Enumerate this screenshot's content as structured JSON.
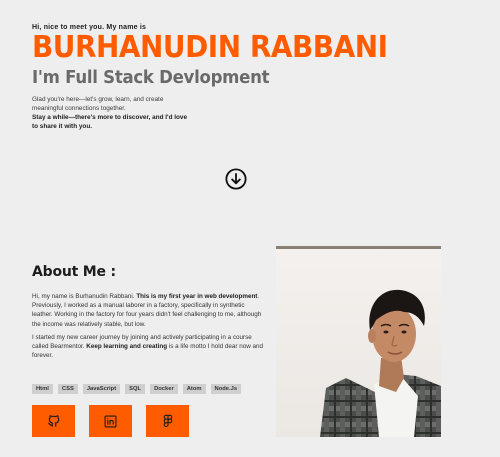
{
  "hero": {
    "greeting": "Hi, nice to meet you. My name is",
    "name": "BURHANUDIN RABBANI",
    "role": "I'm Full Stack Devlopment",
    "intro_plain": "Glad you're here—let's grow, learn, and create meaningful connections together.",
    "intro_bold": "Stay a while—there's more to discover, and I'd love to share it with you."
  },
  "scroll": {
    "icon": "arrow-down-circle-icon"
  },
  "about": {
    "title": "About Me :",
    "p1_a": "Hi, my name is Burhanudin Rabbani. ",
    "p1_b": "This is my first year in web development",
    "p1_c": ". Previously, I worked as a manual laborer in a factory, specifically in synthetic leather. Working in the factory for four years didn't feel challenging to me, although the income was relatively stable, but low.",
    "p2_a": "I started my new career journey by joining and actively participating in a course called Bearmentor. ",
    "p2_b": "Keep learning and creating",
    "p2_c": " is a life motto I hold dear now and forever."
  },
  "skills": [
    "Html",
    "CSS",
    "JavaScript",
    "SQL",
    "Docker",
    "Atom",
    "Node.Js"
  ],
  "socials": [
    {
      "name": "github",
      "icon": "github-icon"
    },
    {
      "name": "linkedin",
      "icon": "linkedin-icon"
    },
    {
      "name": "figma",
      "icon": "figma-icon"
    }
  ],
  "colors": {
    "accent": "#ff5c00",
    "background": "#eeeeee",
    "text": "#1d1d1d",
    "subtitle": "#6a6a6a"
  }
}
